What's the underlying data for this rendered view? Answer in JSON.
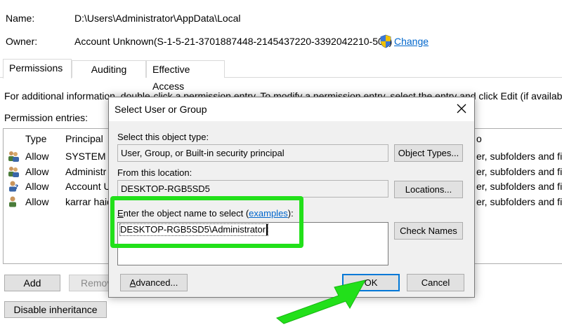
{
  "window": {
    "name_label": "Name:",
    "name_value": "D:\\Users\\Administrator\\AppData\\Local",
    "owner_label": "Owner:",
    "owner_value": "Account Unknown(S-1-5-21-3701887448-2145437220-3392042210-500)",
    "change_link": "Change",
    "tabs": [
      {
        "label": "Permissions",
        "active": true
      },
      {
        "label": "Auditing",
        "active": false
      },
      {
        "label": "Effective Access",
        "active": false
      }
    ],
    "info_text": "For additional information, double-click a permission entry. To modify a permission entry, select the entry and click Edit (if available).",
    "entries_label": "Permission entries:",
    "columns": {
      "type": "Type",
      "principal": "Principal",
      "applies_to": "o"
    },
    "rows": [
      {
        "type": "Allow",
        "principal": "SYSTEM",
        "applies": "er, subfolders and file"
      },
      {
        "type": "Allow",
        "principal": "Administr",
        "applies": "er, subfolders and file"
      },
      {
        "type": "Allow",
        "principal": "Account U",
        "applies": "er, subfolders and file"
      },
      {
        "type": "Allow",
        "principal": "karrar haid",
        "applies": "er, subfolders and file"
      }
    ],
    "add_button": "Add",
    "remove_button": "Remov",
    "disable_inheritance_button": "Disable inheritance"
  },
  "dialog": {
    "title": "Select User or Group",
    "object_type_label": "Select this object type:",
    "object_type_value": "User, Group, or Built-in security principal",
    "object_types_button": "Object Types...",
    "location_label": "From this location:",
    "location_value": "DESKTOP-RGB5SD5",
    "locations_button": "Locations...",
    "enter_label_prefix": "E",
    "enter_label_rest": "nter the object name to select (",
    "examples_link": "examples",
    "enter_label_suffix": "):",
    "object_name_value": "DESKTOP-RGB5SD5\\Administrator",
    "check_names_button": "Check Names",
    "advanced_button_prefix": "A",
    "advanced_button_rest": "dvanced...",
    "ok_button": "OK",
    "cancel_button": "Cancel"
  },
  "colors": {
    "highlight": "#22e01a",
    "accent": "#0078d7",
    "link": "#0066cc"
  }
}
